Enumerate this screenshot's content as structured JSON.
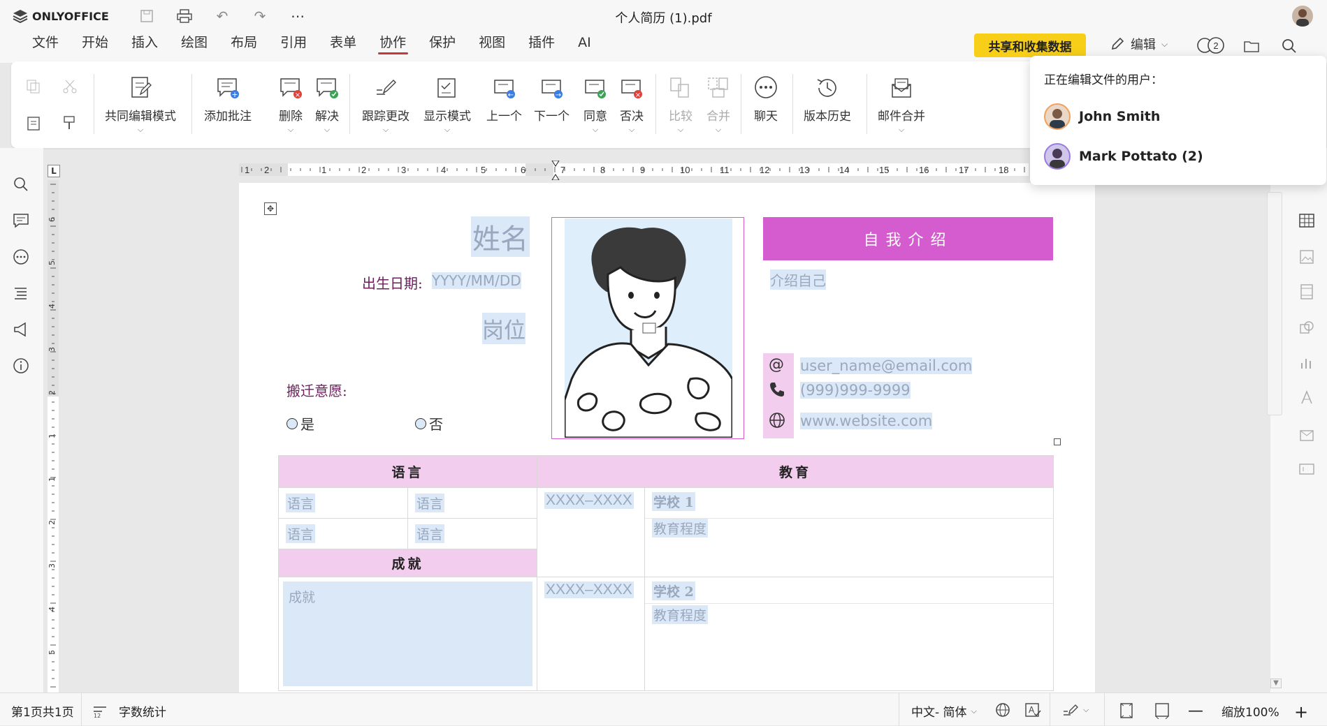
{
  "app": {
    "name": "ONLYOFFICE",
    "title": "个人简历 (1).pdf"
  },
  "menu": [
    "文件",
    "开始",
    "插入",
    "绘图",
    "布局",
    "引用",
    "表单",
    "协作",
    "保护",
    "视图",
    "插件",
    "AI"
  ],
  "share_button": "共享和收集数据",
  "edit_mode": "编辑",
  "users_count": "2",
  "ribbon": {
    "coedit": "共同编辑模式",
    "add_comment": "添加批注",
    "delete": "删除",
    "resolve": "解决",
    "track": "跟踪更改",
    "display": "显示模式",
    "prev": "上一个",
    "next": "下一个",
    "accept": "同意",
    "reject": "否决",
    "compare": "比较",
    "merge": "合并",
    "chat": "聊天",
    "history": "版本历史",
    "mailmerge": "邮件合并"
  },
  "popover": {
    "title": "正在编辑文件的用户：",
    "users": [
      "John Smith",
      "Mark Pottato (2)"
    ]
  },
  "ruler": {
    "h": [
      "1",
      "2",
      "1",
      "2",
      "3",
      "4",
      "5",
      "6",
      "7",
      "8",
      "9",
      "10",
      "11",
      "12",
      "13",
      "14",
      "15",
      "16",
      "17",
      "18"
    ],
    "v": [
      "6",
      "5",
      "4",
      "3",
      "2",
      "1",
      "1",
      "2",
      "3",
      "4",
      "5"
    ]
  },
  "doc": {
    "name": "姓名",
    "birth_label": "出生日期:",
    "birth_value": "YYYY/MM/DD",
    "position": "岗位",
    "relocate_label": "搬迁意愿:",
    "yes": "是",
    "no": "否",
    "intro_header": "自我介绍",
    "intro_text": "介绍自己",
    "email": "user_name@email.com",
    "phone": "(999)999-9999",
    "website": "www.website.com",
    "lang_header": "语言",
    "edu_header": "教育",
    "lang": [
      "语言",
      "语言",
      "语言",
      "语言"
    ],
    "achieve_header": "成就",
    "achieve_text": "成就",
    "period": "XXXX–XXXX",
    "school1": "学校 1",
    "school2": "学校 2",
    "degree": "教育程度"
  },
  "status": {
    "page": "第1页共1页",
    "wordcount": "字数统计",
    "lang": "中文- 简体",
    "zoom": "缩放100%"
  }
}
